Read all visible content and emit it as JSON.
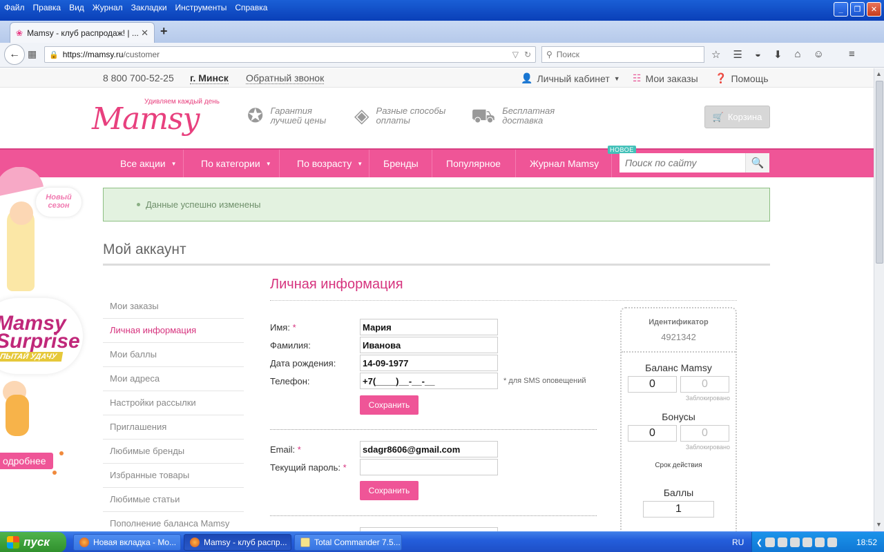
{
  "browser": {
    "menu": [
      "Файл",
      "Правка",
      "Вид",
      "Журнал",
      "Закладки",
      "Инструменты",
      "Справка"
    ],
    "tab_title": "Mamsy - клуб распродаж! | ...",
    "url_host": "https://mamsy.ru",
    "url_path": "/customer",
    "search_placeholder": "Поиск"
  },
  "topbar": {
    "phone": "8 800 700-52-25",
    "city": "г. Минск",
    "callback": "Обратный звонок",
    "account": "Личный кабинет",
    "orders": "Мои заказы",
    "help": "Помощь"
  },
  "header": {
    "slogan": "Удивляем каждый день",
    "logo": "Mamsy",
    "features": [
      {
        "line1": "Гарантия",
        "line2": "лучшей цены"
      },
      {
        "line1": "Разные способы",
        "line2": "оплаты"
      },
      {
        "line1": "Бесплатная",
        "line2": "доставка"
      }
    ],
    "cart": "Корзина"
  },
  "nav": {
    "items": [
      "Все акции",
      "По категории",
      "По возрасту",
      "Бренды",
      "Популярное",
      "Журнал Mamsy"
    ],
    "new_badge": "НОВОЕ",
    "search_placeholder": "Поиск по сайту"
  },
  "promo": {
    "season": "Новый сезон",
    "brand": "Mamsy",
    "surprise": "Surprise",
    "luck": "ПЫТАЙ УДАЧУ",
    "more": "одробнее"
  },
  "message": "Данные успешно изменены",
  "account_title": "Мой аккаунт",
  "sidemenu": [
    "Мои заказы",
    "Личная информация",
    "Мои баллы",
    "Мои адреса",
    "Настройки рассылки",
    "Приглашения",
    "Любимые бренды",
    "Избранные товары",
    "Любимые статьи",
    "Пополнение баланса Mamsy"
  ],
  "personal": {
    "title": "Личная информация",
    "name_label": "Имя:",
    "name_value": "Мария",
    "surname_label": "Фамилия:",
    "surname_value": "Иванова",
    "birth_label": "Дата рождения:",
    "birth_value": "14-09-1977",
    "phone_label": "Телефон:",
    "phone_value": "+7(____)__-__-__",
    "phone_hint": "* для SMS оповещений",
    "save": "Сохранить",
    "email_label": "Email:",
    "email_value": "sdagr8606@gmail.com",
    "password_label": "Текущий пароль:",
    "password_value": ""
  },
  "widget": {
    "id_label": "Идентификатор",
    "id_value": "4921342",
    "balance_label": "Баланс Mamsy",
    "balance": "0",
    "balance_blocked": "0",
    "blocked_label": "Заблокировано",
    "bonus_label": "Бонусы",
    "bonus": "0",
    "bonus_blocked": "0",
    "expiry_label": "Срок действия",
    "points_label": "Баллы",
    "points": "1"
  },
  "taskbar": {
    "start": "пуск",
    "tasks": [
      "Новая вкладка - Mo...",
      "Mamsy - клуб распр...",
      "Total Commander 7.5..."
    ],
    "lang": "RU",
    "time": "18:52"
  }
}
